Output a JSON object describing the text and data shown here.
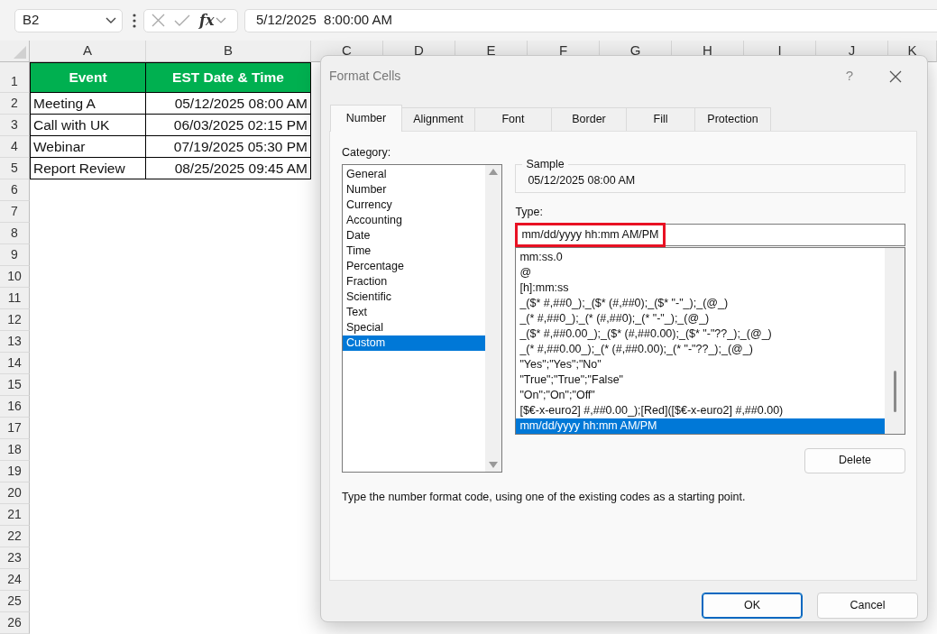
{
  "formula_bar": {
    "name_box": "B2",
    "function_label": "fx",
    "value": "5/12/2025  8:00:00 AM"
  },
  "sheet": {
    "columns": [
      "A",
      "B",
      "C",
      "D",
      "E",
      "F",
      "G",
      "H",
      "I",
      "J",
      "K"
    ],
    "rows": [
      "1",
      "2",
      "3",
      "4",
      "5",
      "6",
      "7",
      "8",
      "9",
      "10",
      "11",
      "12",
      "13",
      "14",
      "15",
      "16",
      "17",
      "18",
      "19",
      "20",
      "21",
      "22",
      "23",
      "24",
      "25",
      "26"
    ],
    "table": {
      "header": [
        "Event",
        "EST Date & Time"
      ],
      "rows": [
        [
          "Meeting A",
          "05/12/2025 08:00 AM"
        ],
        [
          "Call with UK",
          "06/03/2025 02:15 PM"
        ],
        [
          "Webinar",
          "07/19/2025 05:30 PM"
        ],
        [
          "Report Review",
          "08/25/2025 09:45 AM"
        ]
      ]
    }
  },
  "dialog": {
    "title": "Format Cells",
    "help": "?",
    "tabs": [
      {
        "label": "Number",
        "selected": true
      },
      {
        "label": "Alignment",
        "selected": false
      },
      {
        "label": "Font",
        "selected": false
      },
      {
        "label": "Border",
        "selected": false
      },
      {
        "label": "Fill",
        "selected": false
      },
      {
        "label": "Protection",
        "selected": false
      }
    ],
    "category_label": "Category:",
    "categories": [
      {
        "label": "General",
        "selected": false
      },
      {
        "label": "Number",
        "selected": false
      },
      {
        "label": "Currency",
        "selected": false
      },
      {
        "label": "Accounting",
        "selected": false
      },
      {
        "label": "Date",
        "selected": false
      },
      {
        "label": "Time",
        "selected": false
      },
      {
        "label": "Percentage",
        "selected": false
      },
      {
        "label": "Fraction",
        "selected": false
      },
      {
        "label": "Scientific",
        "selected": false
      },
      {
        "label": "Text",
        "selected": false
      },
      {
        "label": "Special",
        "selected": false
      },
      {
        "label": "Custom",
        "selected": true
      }
    ],
    "sample": {
      "label": "Sample",
      "value": "05/12/2025 08:00 AM"
    },
    "type": {
      "label": "Type:",
      "value": "mm/dd/yyyy hh:mm AM/PM",
      "highlighted": true
    },
    "formats": [
      {
        "label": "mm:ss.0",
        "selected": false
      },
      {
        "label": "@",
        "selected": false
      },
      {
        "label": "[h]:mm:ss",
        "selected": false
      },
      {
        "label": "_($* #,##0_);_($* (#,##0);_($* \"-\"_);_(@_)",
        "selected": false
      },
      {
        "label": "_(* #,##0_);_(* (#,##0);_(* \"-\"_);_(@_)",
        "selected": false
      },
      {
        "label": "_($* #,##0.00_);_($* (#,##0.00);_($* \"-\"??_);_(@_)",
        "selected": false
      },
      {
        "label": "_(* #,##0.00_);_(* (#,##0.00);_(* \"-\"??_);_(@_)",
        "selected": false
      },
      {
        "label": "\"Yes\";\"Yes\";\"No\"",
        "selected": false
      },
      {
        "label": "\"True\";\"True\";\"False\"",
        "selected": false
      },
      {
        "label": "\"On\";\"On\";\"Off\"",
        "selected": false
      },
      {
        "label": "[$€-x-euro2] #,##0.00_);[Red]([$€-x-euro2] #,##0.00)",
        "selected": false
      },
      {
        "label": "mm/dd/yyyy hh:mm AM/PM",
        "selected": true
      }
    ],
    "delete_button": "Delete",
    "hint": "Type the number format code, using one of the existing codes as a starting point.",
    "buttons": [
      {
        "label": "OK",
        "default": true
      },
      {
        "label": "Cancel",
        "default": false
      }
    ]
  }
}
